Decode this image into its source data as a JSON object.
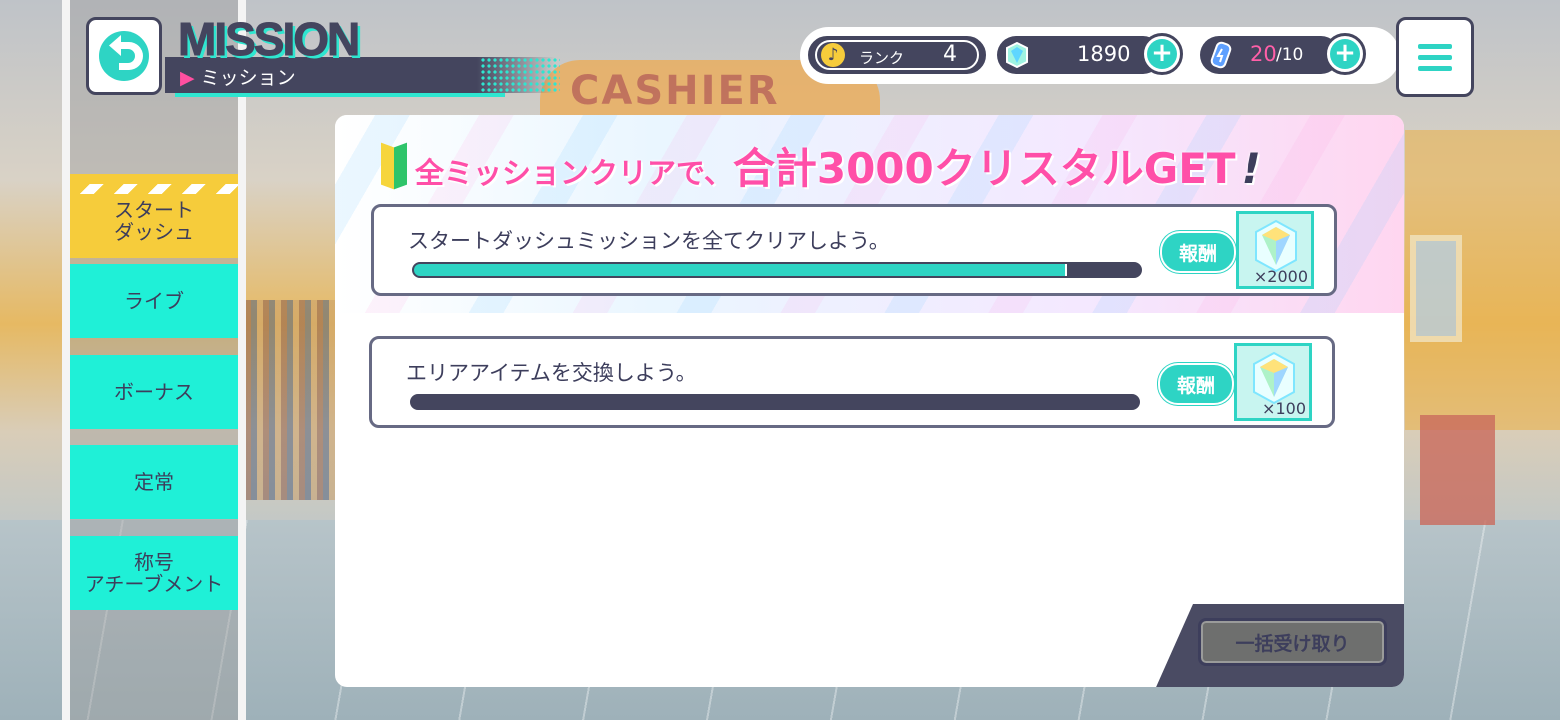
{
  "header": {
    "title_en": "MISSION",
    "title_jp": "ミッション"
  },
  "status": {
    "rank_label": "ランク",
    "rank_value": "4",
    "crystals": "1890",
    "stamina_current": "20",
    "stamina_max": "/10",
    "plus_label": "+"
  },
  "sidebar": {
    "items": [
      {
        "label": "スタート\nダッシュ",
        "active": true
      },
      {
        "label": "ライブ",
        "active": false
      },
      {
        "label": "ボーナス",
        "active": false
      },
      {
        "label": "定常",
        "active": false
      },
      {
        "label": "称号\nアチーブメント",
        "active": false
      }
    ]
  },
  "banner": {
    "part1": "全ミッションクリアで、",
    "part2": "合計3000クリスタルGET",
    "part3": "!"
  },
  "missions": [
    {
      "text": "スタートダッシュミッションを全てクリアしよう。",
      "progress": 0.9,
      "reward_label": "報酬",
      "reward_qty": "×2000"
    },
    {
      "text": "エリアアイテムを交換しよう。",
      "progress": 0,
      "reward_label": "報酬",
      "reward_qty": "×100"
    }
  ],
  "collect_all_label": "一括受け取り",
  "background_sign": "CASHIER",
  "colors": {
    "accent": "#2ed4c4",
    "navy": "#44455e",
    "pink": "#ff4fa8",
    "tab_active": "#f6cc3b",
    "tab": "#1ff0d7"
  }
}
